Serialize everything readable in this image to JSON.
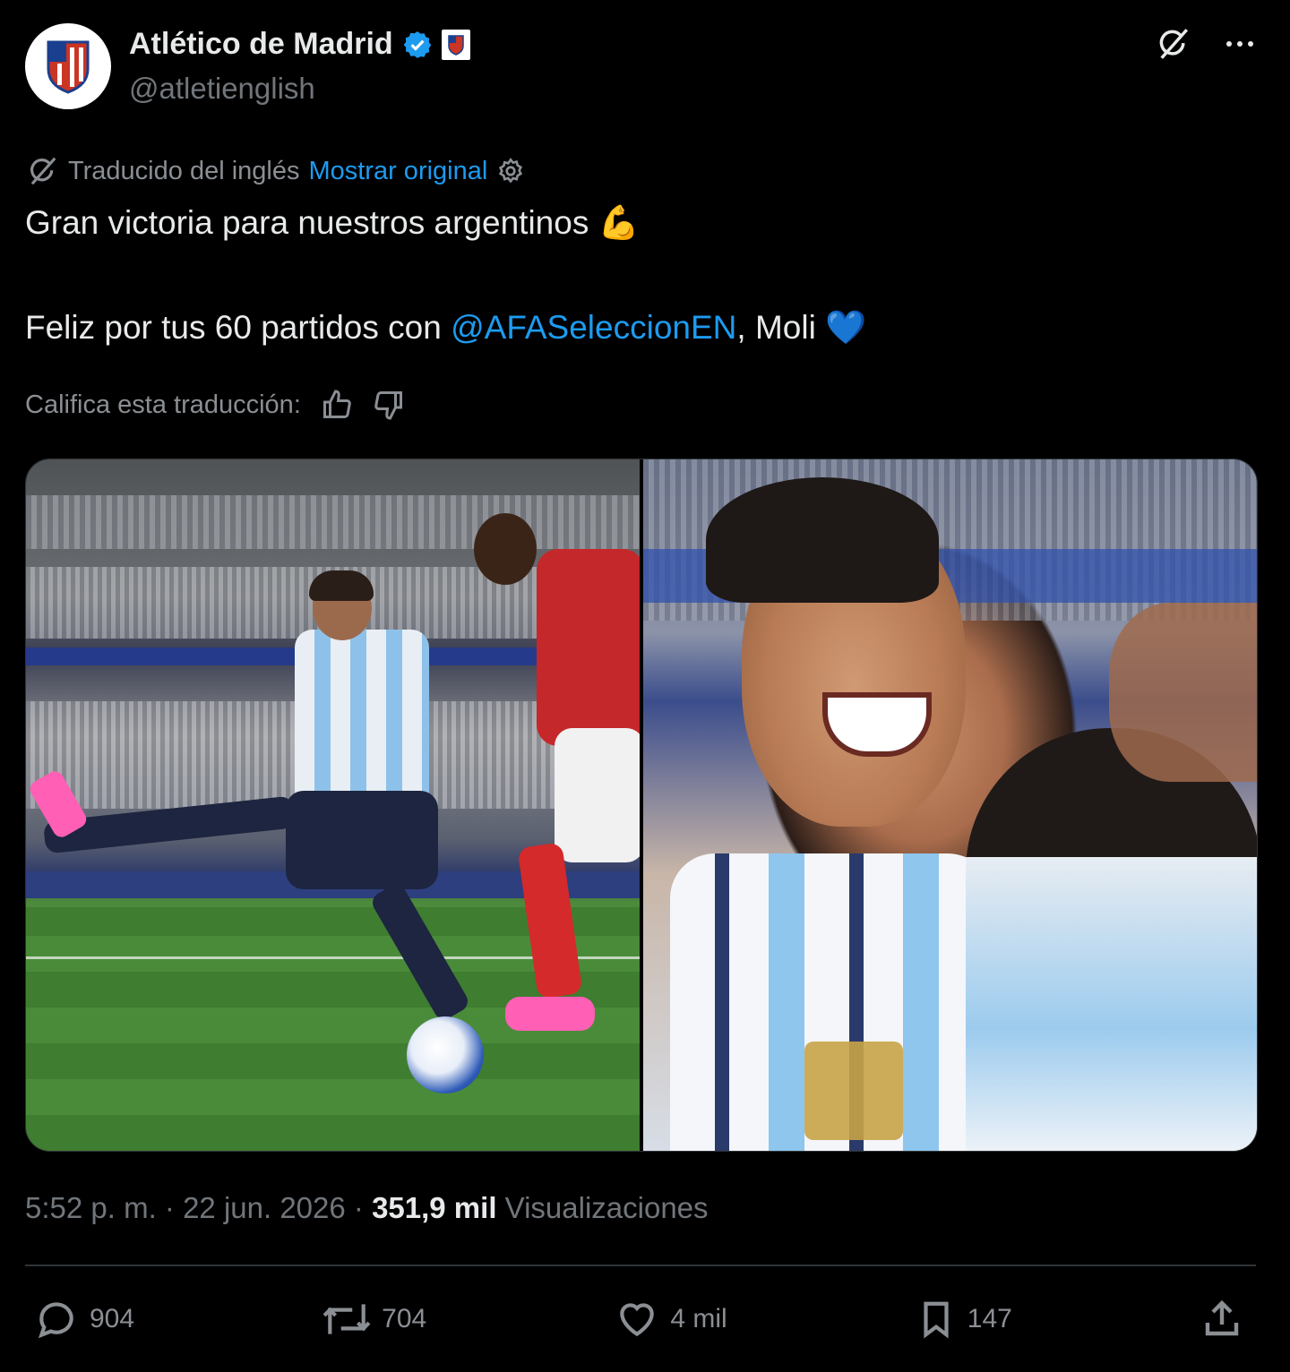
{
  "header": {
    "display_name": "Atlético de Madrid",
    "handle": "@atletienglish",
    "verified_icon": "verified-badge-icon",
    "affiliate_icon": "club-affiliate-badge-icon",
    "grok_icon": "grok-icon",
    "more_icon": "more-options-icon"
  },
  "translation": {
    "label": "Traducido del inglés",
    "show_original": "Mostrar original"
  },
  "tweet": {
    "line1": "Gran victoria para nuestros argentinos",
    "line1_emoji": "💪",
    "line2_prefix": "Feliz por tus 60 partidos con ",
    "mention": "@AFASeleccionEN",
    "line2_suffix": ", Moli",
    "line2_emoji": "💙"
  },
  "rate": {
    "label": "Califica esta traducción:"
  },
  "media": {
    "photo_count": 2
  },
  "meta": {
    "time_date": "5:52 p. m. · 22 jun. 2026 · ",
    "views_count": "351,9 mil",
    "views_label": " Visualizaciones"
  },
  "actions": {
    "replies": "904",
    "reposts": "704",
    "likes": "4 mil",
    "bookmarks": "147"
  },
  "colors": {
    "background": "#000000",
    "text": "#e7e9ea",
    "muted": "#71767b",
    "accent": "#1d9bf0"
  }
}
